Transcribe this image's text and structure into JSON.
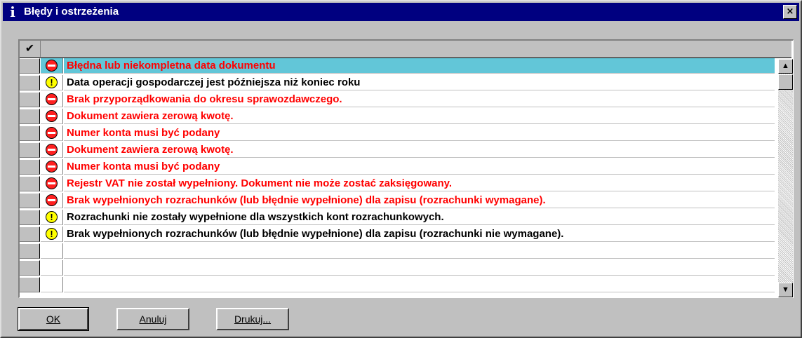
{
  "window": {
    "title": "Błędy i ostrzeżenia",
    "close_label": "×"
  },
  "grid": {
    "header_check": "✔",
    "rows": [
      {
        "type": "error",
        "text": "Błędna lub niekompletna data dokumentu",
        "selected": true
      },
      {
        "type": "warning",
        "text": "Data operacji gospodarczej jest późniejsza niż koniec roku"
      },
      {
        "type": "error",
        "text": "Brak przyporządkowania do okresu sprawozdawczego."
      },
      {
        "type": "error",
        "text": "Dokument zawiera zerową kwotę."
      },
      {
        "type": "error",
        "text": "Numer konta musi być podany"
      },
      {
        "type": "error",
        "text": "Dokument zawiera zerową kwotę."
      },
      {
        "type": "error",
        "text": "Numer konta musi być podany"
      },
      {
        "type": "error",
        "text": "Rejestr VAT nie został wypełniony. Dokument nie może zostać zaksięgowany."
      },
      {
        "type": "error",
        "text": "Brak wypełnionych rozrachunków (lub błędnie wypełnione) dla zapisu (rozrachunki wymagane)."
      },
      {
        "type": "warning",
        "text": "Rozrachunki nie zostały wypełnione dla wszystkich kont rozrachunkowych."
      },
      {
        "type": "warning",
        "text": "Brak wypełnionych rozrachunków (lub błędnie wypełnione) dla zapisu (rozrachunki nie wymagane)."
      },
      {
        "type": "empty",
        "text": ""
      },
      {
        "type": "empty",
        "text": ""
      },
      {
        "type": "empty",
        "text": ""
      }
    ]
  },
  "buttons": {
    "ok": "OK",
    "cancel": "Anuluj",
    "print": "Drukuj..."
  },
  "icons": {
    "error": "error-icon",
    "warning": "warning-icon",
    "info": "info-icon"
  },
  "colors": {
    "error_text": "#ff0000",
    "selection": "#62c6d8",
    "titlebar": "#000080"
  }
}
